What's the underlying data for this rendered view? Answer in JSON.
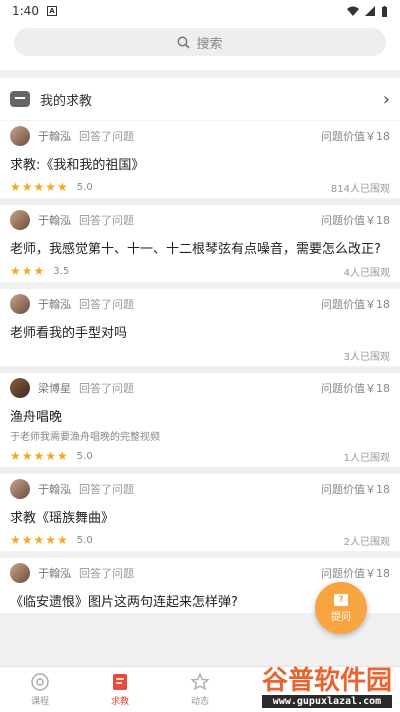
{
  "status_bar": {
    "time": "1:40",
    "a_icon": "A"
  },
  "search": {
    "label": "搜索"
  },
  "my_help": {
    "label": "我的求教"
  },
  "questions": [
    {
      "author": "于翰泓",
      "action": "回答了问题",
      "value_label": "问题价值",
      "price": "￥18",
      "title": "求教:《我和我的祖国》",
      "desc": "",
      "stars": "★★★★★",
      "rating": "5.0",
      "watchers": "814人已围观"
    },
    {
      "author": "于翰泓",
      "action": "回答了问题",
      "value_label": "问题价值",
      "price": "￥18",
      "title": "老师，我感觉第十、十一、十二根琴弦有点噪音，需要怎么改正?",
      "desc": "",
      "stars": "★★★",
      "rating": "3.5",
      "watchers": "4人已围观"
    },
    {
      "author": "于翰泓",
      "action": "回答了问题",
      "value_label": "问题价值",
      "price": "￥18",
      "title": "老师看我的手型对吗",
      "desc": "",
      "stars": "",
      "rating": "",
      "watchers": "3人已围观"
    },
    {
      "author": "梁博星",
      "action": "回答了问题",
      "value_label": "问题价值",
      "price": "￥18",
      "title": "渔舟唱晚",
      "desc": "于老师我需要渔舟唱晚的完整视频",
      "stars": "★★★★★",
      "rating": "5.0",
      "watchers": "1人已围观"
    },
    {
      "author": "于翰泓",
      "action": "回答了问题",
      "value_label": "问题价值",
      "price": "￥18",
      "title": "求教《瑶族舞曲》",
      "desc": "",
      "stars": "★★★★★",
      "rating": "5.0",
      "watchers": "2人已围观"
    },
    {
      "author": "于翰泓",
      "action": "回答了问题",
      "value_label": "问题价值",
      "price": "￥18",
      "title": "《临安遗恨》图片这两句连起来怎样弹?",
      "desc": "",
      "stars": "",
      "rating": "",
      "watchers": ""
    }
  ],
  "fab": {
    "icon": "?",
    "label": "提问"
  },
  "nav": [
    {
      "label": "课程",
      "icon": "disc-icon"
    },
    {
      "label": "求教",
      "icon": "edit-icon",
      "active": true
    },
    {
      "label": "动态",
      "icon": "star-icon"
    }
  ],
  "watermark": {
    "main": "谷普软件园",
    "sub": "www.gupuxlazal.com"
  },
  "colors": {
    "accent": "#e84a3b",
    "star": "#f5a623",
    "fab": "#f7a441"
  }
}
